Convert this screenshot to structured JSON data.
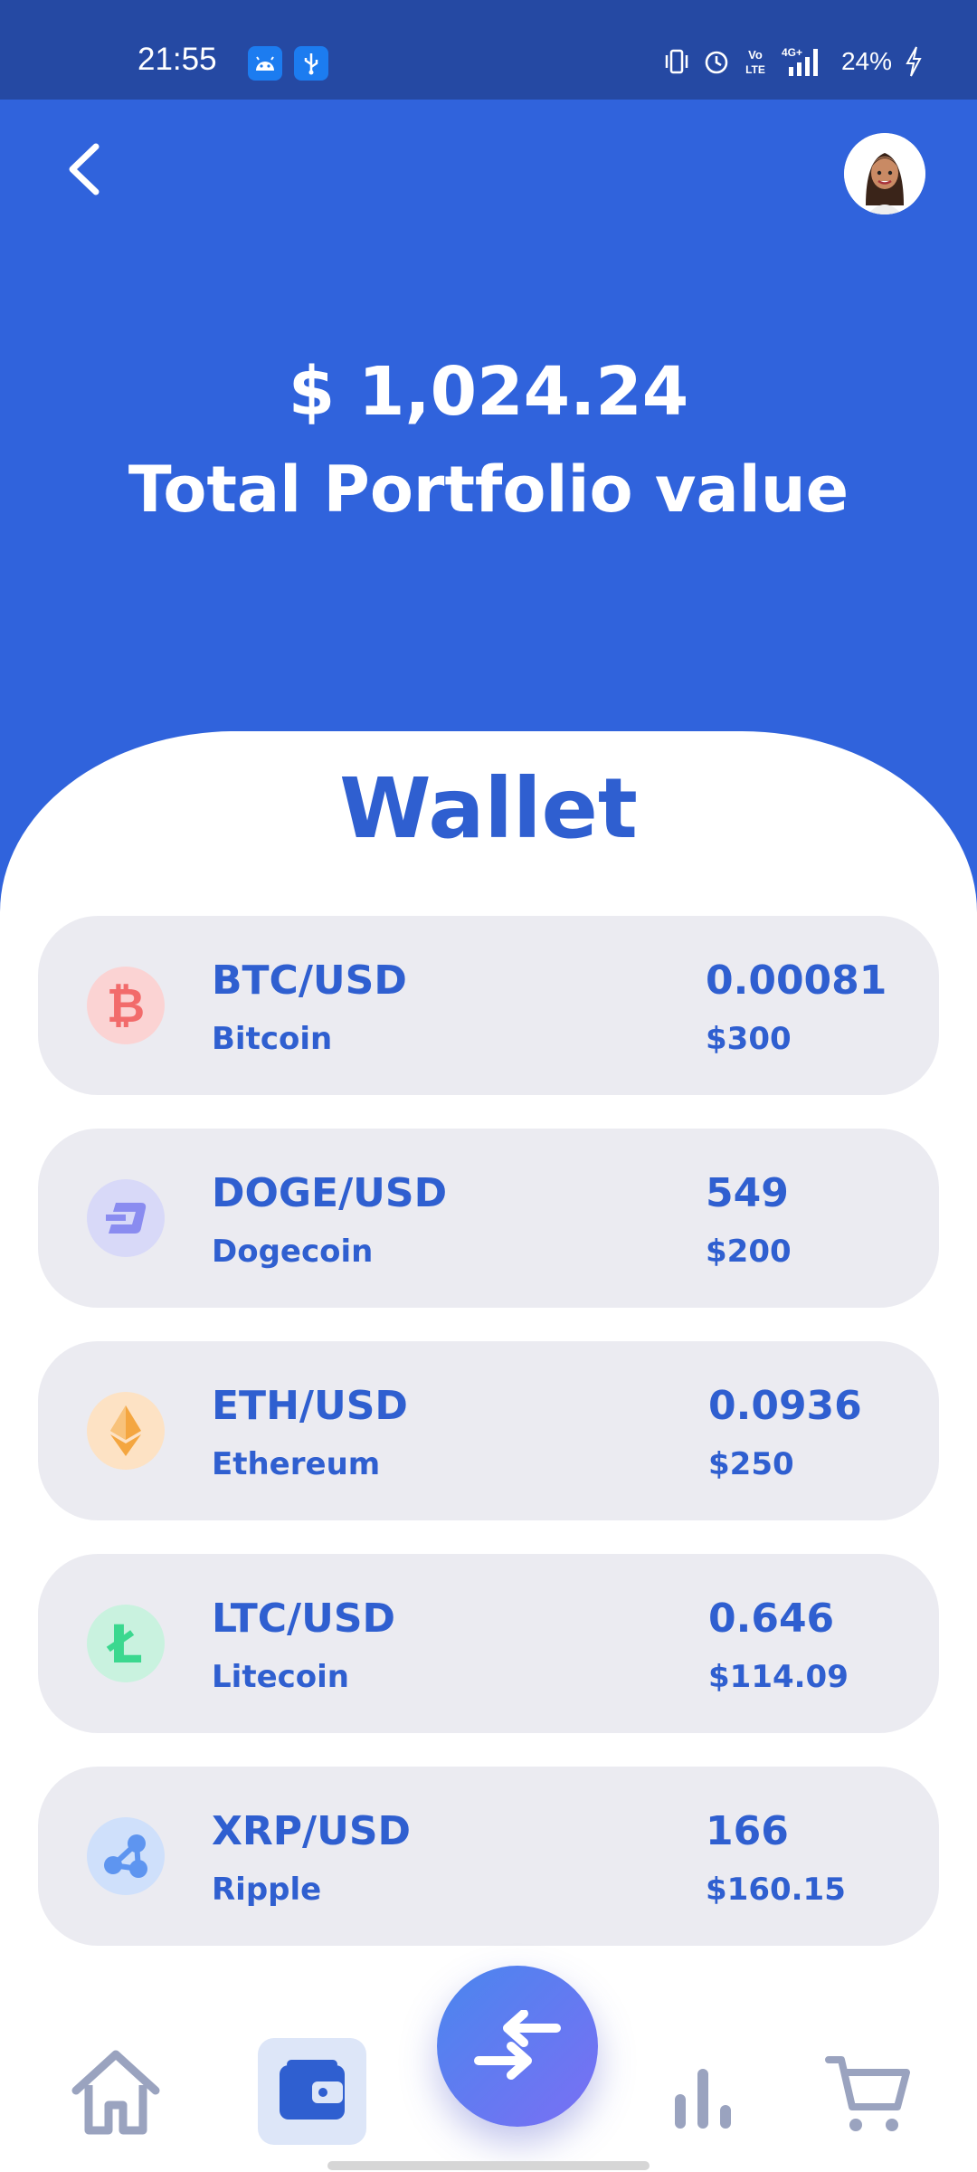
{
  "status_bar": {
    "time": "21:55",
    "battery": "24%",
    "icons": [
      "android-icon",
      "usb-icon",
      "vibrate-icon",
      "alarm-icon",
      "volte-icon",
      "signal-icon",
      "charging-icon"
    ],
    "network": "4G+",
    "volte": "Vo LTE"
  },
  "header": {
    "back_icon": "chevron-left-icon",
    "avatar": "user-avatar"
  },
  "portfolio": {
    "total_value": "$ 1,024.24",
    "label": "Total Portfolio value"
  },
  "wallet": {
    "title": "Wallet",
    "coins": [
      {
        "pair": "BTC/USD",
        "name": "Bitcoin",
        "amount": "0.00081",
        "value": "$300",
        "icon": "bitcoin-icon",
        "color": "#f26b6b",
        "bg": "#fbd3d3"
      },
      {
        "pair": "DOGE/USD",
        "name": "Dogecoin",
        "amount": "549",
        "value": "$200",
        "icon": "dash-icon",
        "color": "#8a8cf0",
        "bg": "#d8d9f8"
      },
      {
        "pair": "ETH/USD",
        "name": "Ethereum",
        "amount": "0.0936",
        "value": "$250",
        "icon": "ethereum-icon",
        "color": "#f4a640",
        "bg": "#fde2c4"
      },
      {
        "pair": "LTC/USD",
        "name": "Litecoin",
        "amount": "0.646",
        "value": "$114.09",
        "icon": "litecoin-icon",
        "color": "#3bd88f",
        "bg": "#c9f2df"
      },
      {
        "pair": "XRP/USD",
        "name": "Ripple",
        "amount": "166",
        "value": "$160.15",
        "icon": "ripple-icon",
        "color": "#5e95f0",
        "bg": "#cfe0fb"
      }
    ]
  },
  "bottom_nav": {
    "items": [
      "home-icon",
      "wallet-icon",
      "exchange-icon",
      "stats-icon",
      "cart-icon"
    ],
    "active": "wallet",
    "accent": "#2f5fd0",
    "inactive": "#9aa3bf"
  },
  "colors": {
    "primary": "#3063dc",
    "status_bar": "#2549a3",
    "card_bg": "#ebebf1",
    "text_accent": "#2f5fd0"
  }
}
